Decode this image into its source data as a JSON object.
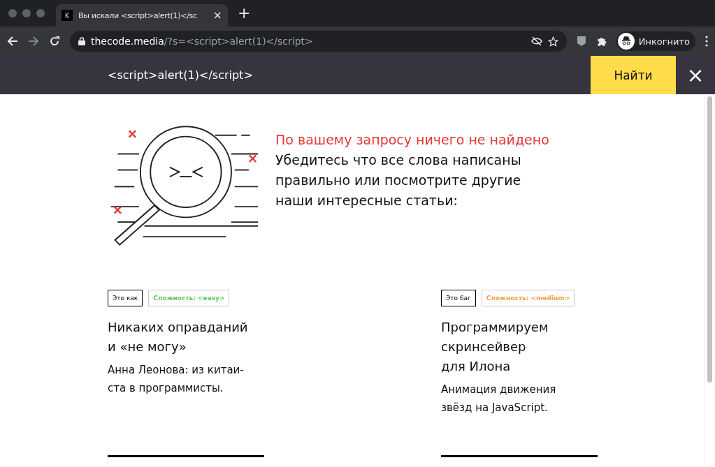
{
  "browser": {
    "tab": {
      "favicon": "K",
      "title": "Вы искали <script>alert(1)</sc",
      "close": "×"
    },
    "new_tab": "+",
    "url": {
      "host": "thecode.media",
      "path": "/?s=<script>alert(1)</script>"
    },
    "profile": "Инкогнито"
  },
  "search": {
    "value": "<script>alert(1)</script>",
    "button": "Найти",
    "close": "×"
  },
  "message": {
    "title": "По вашему запросу ничего не найдено",
    "lines": [
      "Убедитесь что все слова написаны",
      "правильно или посмотрите другие",
      "наши интересные статьи:"
    ]
  },
  "articles": [
    {
      "tag": "Это как",
      "difficulty": "Сложность: <easy>",
      "color": "#5ac85a",
      "title_lines": [
        "Никаких оправданий",
        "и «не могу»"
      ],
      "desc_lines": [
        "Анна Леонова: из китаи-",
        "ста в программисты."
      ]
    },
    {
      "tag": "Это баг",
      "difficulty": "Сложность: <medium>",
      "color": "#f0a040",
      "title_lines": [
        "Программируем",
        "скринсейвер",
        "для Илона"
      ],
      "desc_lines": [
        "Анимация движения",
        "звёзд на JavaScript."
      ]
    }
  ]
}
